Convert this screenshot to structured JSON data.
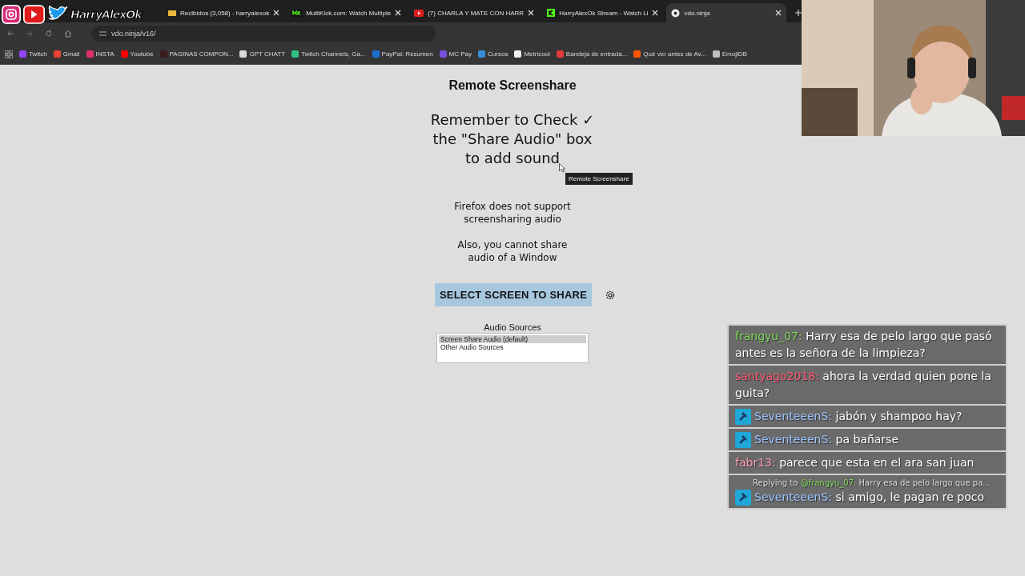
{
  "overlay_logo": {
    "name": "HarryAlexOk"
  },
  "tabs": [
    {
      "title": "Recibidos (3,058) - harryalexok",
      "kind": "mail",
      "selected": false
    },
    {
      "title": "MultiKick.com: Watch Multiple",
      "kind": "mk",
      "selected": false
    },
    {
      "title": "(7) CHARLA Y MATE CON HARR",
      "kind": "youtube",
      "selected": false
    },
    {
      "title": "HarryAlexOk Stream - Watch Li",
      "kind": "kick",
      "selected": false
    },
    {
      "title": "vdo.ninja",
      "kind": "globe",
      "selected": true
    }
  ],
  "address_bar": {
    "url": "vdo.ninja/v16/"
  },
  "bookmarks": [
    {
      "label": "Twitch",
      "color": "#9146ff"
    },
    {
      "label": "Gmail",
      "color": "#ea4335"
    },
    {
      "label": "INSTA",
      "color": "#e1306c"
    },
    {
      "label": "Youtube",
      "color": "#ff0000"
    },
    {
      "label": "PAGINAS COMPON...",
      "color": "#3a1a1a"
    },
    {
      "label": "GPT CHATT",
      "color": "#d9d9d9"
    },
    {
      "label": "Twitch Channels, Ga...",
      "color": "#2ec27e"
    },
    {
      "label": "PayPal: Resumen",
      "color": "#1f6fd1"
    },
    {
      "label": "MC Pay",
      "color": "#7b4fe0"
    },
    {
      "label": "Cursos",
      "color": "#3a8fd8"
    },
    {
      "label": "Metricool",
      "color": "#f0f0f0"
    },
    {
      "label": "Bandeja de entrada...",
      "color": "#e03c3c"
    },
    {
      "label": "Qué ver antes de Av...",
      "color": "#ff5700"
    },
    {
      "label": "EmojiDB",
      "color": "#bdbdbd"
    }
  ],
  "page": {
    "title": "Remote Screenshare",
    "reminder": [
      "Remember to Check ✓",
      "the \"Share Audio\" box",
      "to add sound"
    ],
    "tooltip": "Remote Screenshare",
    "notes": [
      [
        "Firefox does not support",
        "screensharing audio"
      ],
      [
        "Also, you cannot share",
        "audio of a Window"
      ]
    ],
    "share_button": "SELECT SCREEN TO SHARE",
    "audio_sources": {
      "label": "Audio Sources",
      "options": [
        {
          "label": "Screen Share Audio (default)",
          "selected": true
        },
        {
          "label": "Other Audio Sources",
          "selected": false
        }
      ]
    }
  },
  "chat": [
    {
      "kind": "plain",
      "user": "frangyu_07:",
      "color": "#7ed957",
      "text": "Harry esa de pelo largo que pasó antes es la señora de la limpieza?"
    },
    {
      "kind": "plain",
      "user": "santyago2018:",
      "color": "#ff5a78",
      "text": "ahora la verdad quien pone la guita?"
    },
    {
      "kind": "badge",
      "user": "SeventeeenS:",
      "color": "#9cc4ff",
      "text": "jabón y shampoo hay?"
    },
    {
      "kind": "badge",
      "user": "SeventeeenS:",
      "color": "#9cc4ff",
      "text": "pa bañarse"
    },
    {
      "kind": "plain",
      "user": "fabr13:",
      "color": "#ffa0b4",
      "text": "parece que esta en el ara san juan"
    },
    {
      "kind": "badge",
      "user": "SeventeeenS:",
      "color": "#9cc4ff",
      "text": "si amigo, le pagan re poco",
      "reply": {
        "prefix": "Replying to",
        "mention": "@frangyu_07:",
        "text": "Harry esa de pelo largo que pa..."
      }
    }
  ]
}
